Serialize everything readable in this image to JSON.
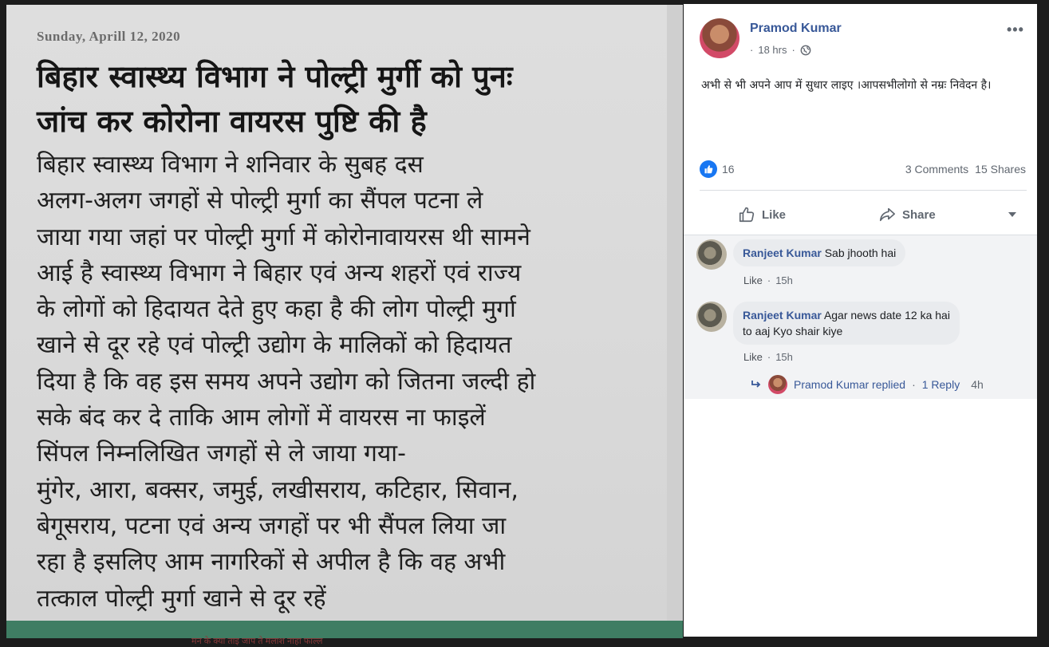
{
  "newspaper": {
    "date": "Sunday, Aprill 12, 2020",
    "headline": [
      "बिहार स्वास्थ्य विभाग ने पोल्ट्री मुर्गी को पुनः",
      "जांच कर कोरोना वायरस पुष्टि की है"
    ],
    "body_lines": [
      "बिहार स्वास्थ्य विभाग ने शनिवार के सुबह दस",
      "अलग-अलग जगहों से पोल्ट्री मुर्गा का सैंपल पटना ले",
      "जाया गया जहां पर पोल्ट्री मुर्गा में कोरोनावायरस थी सामने",
      "आई है स्वास्थ्य विभाग ने बिहार एवं अन्य शहरों एवं राज्य",
      "के लोगों को हिदायत देते हुए कहा है की लोग पोल्ट्री मुर्गा",
      "खाने से दूर रहे एवं पोल्ट्री उद्योग के मालिकों को हिदायत",
      "दिया है कि वह इस समय अपने उद्योग को जितना जल्दी हो",
      "सके बंद कर दे ताकि आम लोगों में वायरस ना फाइलें",
      "सिंपल निम्नलिखित जगहों से ले जाया गया-",
      "मुंगेर, आरा, बक्सर, जमुई, लखीसराय, कटिहार, सिवान,",
      "बेगूसराय, पटना एवं अन्य जगहों पर भी सैंपल लिया जा",
      "रहा है इसलिए आम नागरिकों से अपील है कि वह अभी",
      "तत्काल पोल्ट्री मुर्गा खाने से दूर रहें"
    ],
    "bottom_bleed": "मन के क्या ताइ जाप ते मलाश नाहा फाल्ल"
  },
  "post": {
    "author": "Pramod Kumar",
    "time": "18 hrs",
    "text": "अभी से भी अपने आप में सुधार लाइए ।आपसभीलोगो से नम्रः निवेदन है।",
    "reaction_count": "16",
    "comments_count": "3 Comments",
    "shares_count": "15 Shares",
    "like_label": "Like",
    "share_label": "Share"
  },
  "comments": [
    {
      "author": "Ranjeet Kumar",
      "text": "Sab jhooth hai",
      "like_label": "Like",
      "time": "15h"
    },
    {
      "author": "Ranjeet Kumar",
      "text_line1": "Agar news date 12 ka hai",
      "text_line2": "to aaj Kyo shair kiye",
      "like_label": "Like",
      "time": "15h"
    }
  ],
  "reply_summary": {
    "author_text": "Pramod Kumar replied",
    "separator": "·",
    "replies": "1 Reply",
    "time": "4h"
  },
  "colors": {
    "link_blue": "#385898",
    "like_blue": "#1877f2",
    "meta_grey": "#616770"
  }
}
